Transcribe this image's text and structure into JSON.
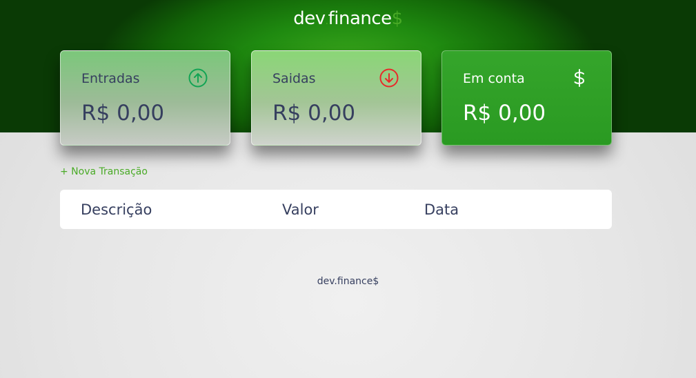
{
  "header": {
    "logo_part1": "dev",
    "logo_dot": ".",
    "logo_part2": "finance",
    "logo_dollar": "$"
  },
  "cards": {
    "income": {
      "label": "Entradas",
      "amount": "R$ 0,00",
      "icon": "arrow-up-circle-icon"
    },
    "expense": {
      "label": "Saidas",
      "amount": "R$ 0,00",
      "icon": "arrow-down-circle-icon"
    },
    "total": {
      "label": "Em conta",
      "amount": "R$ 0,00",
      "icon": "dollar-icon"
    }
  },
  "actions": {
    "new_transaction": "+ Nova Transação"
  },
  "table": {
    "headers": [
      "Descrição",
      "Valor",
      "Data"
    ]
  },
  "footer": {
    "text": "dev.finance$"
  },
  "colors": {
    "brand_green": "#49aa26",
    "text_dark": "#363f5f",
    "income_icon": "#12a454",
    "expense_icon": "#e92929"
  }
}
